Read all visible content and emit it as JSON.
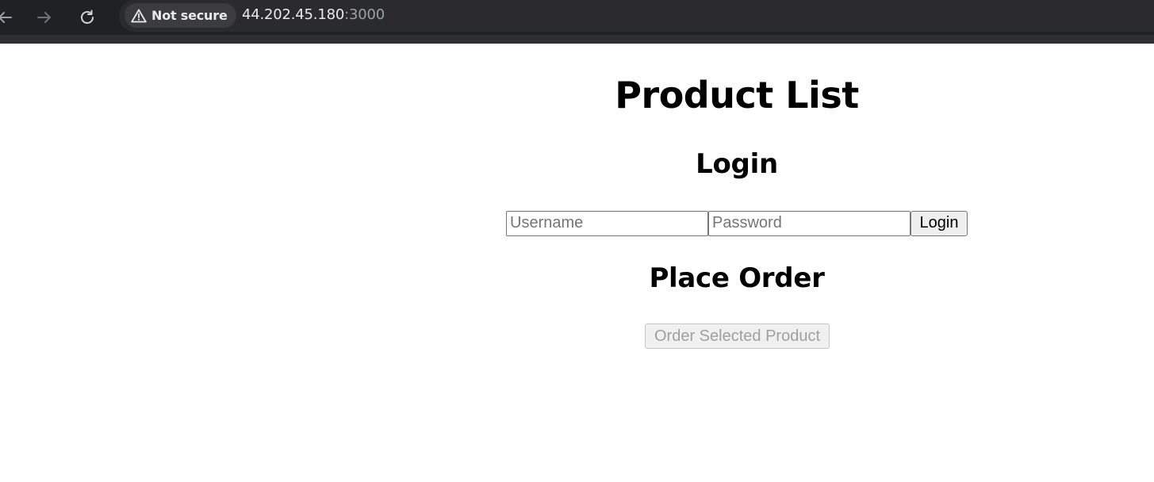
{
  "browser": {
    "security_label": "Not secure",
    "url_host": "44.202.45.180",
    "url_port": ":3000"
  },
  "page": {
    "title": "Product List",
    "login": {
      "heading": "Login",
      "username_placeholder": "Username",
      "username_value": "",
      "password_placeholder": "Password",
      "password_value": "",
      "login_button": "Login"
    },
    "order": {
      "heading": "Place Order",
      "order_button": "Order Selected Product",
      "order_button_disabled": true
    }
  },
  "colors": {
    "chrome_bg": "#202124",
    "page_bg": "#ffffff",
    "text": "#000000"
  }
}
